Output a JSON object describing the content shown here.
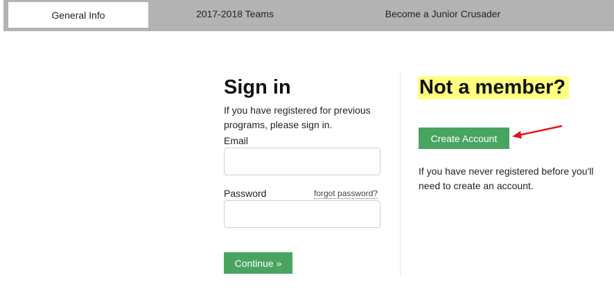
{
  "tabs": [
    {
      "label": "General Info",
      "active": true
    },
    {
      "label": "2017-2018 Teams",
      "active": false
    },
    {
      "label": "Become a Junior Crusader",
      "active": false
    }
  ],
  "signin": {
    "title": "Sign in",
    "intro": "If you have registered for previous programs, please sign in.",
    "email_label": "Email",
    "email_value": "",
    "password_label": "Password",
    "password_value": "",
    "forgot_label": "forgot password?",
    "continue_label": "Continue »"
  },
  "register": {
    "title": "Not a member?",
    "create_label": "Create Account",
    "description": "If you have never registered before you'll need to create an account."
  },
  "colors": {
    "button_green": "#49a461",
    "highlight_yellow": "#ffff80",
    "tabbar_gray": "#b3b3b3",
    "arrow_red": "#e0141e"
  },
  "icons": [
    "red-arrow-icon"
  ]
}
